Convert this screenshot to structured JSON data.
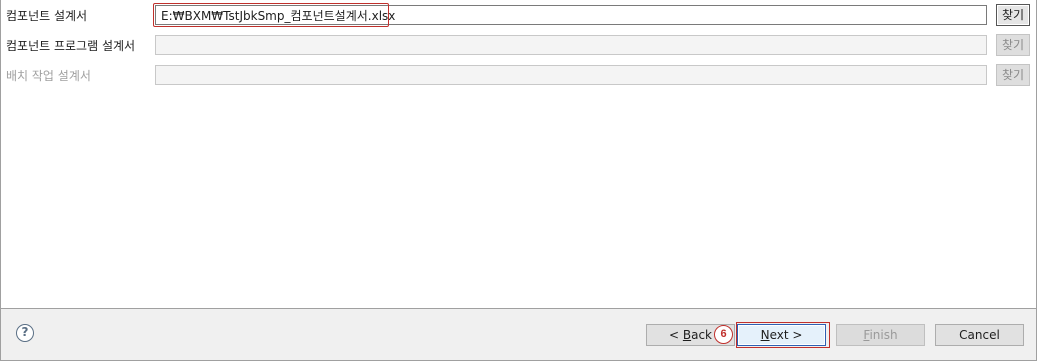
{
  "form": {
    "rows": [
      {
        "label": "컴포넌트 설계서",
        "value": "E:₩BXM₩TstJbkSmp_컴포넌트설계서.xlsx",
        "browse_label": "찾기",
        "enabled": true
      },
      {
        "label": "컴포넌트 프로그램 설계서",
        "value": "",
        "browse_label": "찾기",
        "enabled": true
      },
      {
        "label": "배치 작업 설계서",
        "value": "",
        "browse_label": "찾기",
        "enabled": false
      }
    ]
  },
  "footer": {
    "help_icon": "help-icon",
    "back": {
      "prefix": "< ",
      "mnemonic": "B",
      "rest": "ack"
    },
    "next": {
      "mnemonic": "N",
      "rest": "ext >"
    },
    "finish": {
      "mnemonic": "F",
      "rest": "inish"
    },
    "cancel_label": "Cancel",
    "step_badge": "6"
  },
  "colors": {
    "annotation": "#c0302c",
    "button_face": "#e1e1e1",
    "footer_bg": "#f0f0f0"
  }
}
